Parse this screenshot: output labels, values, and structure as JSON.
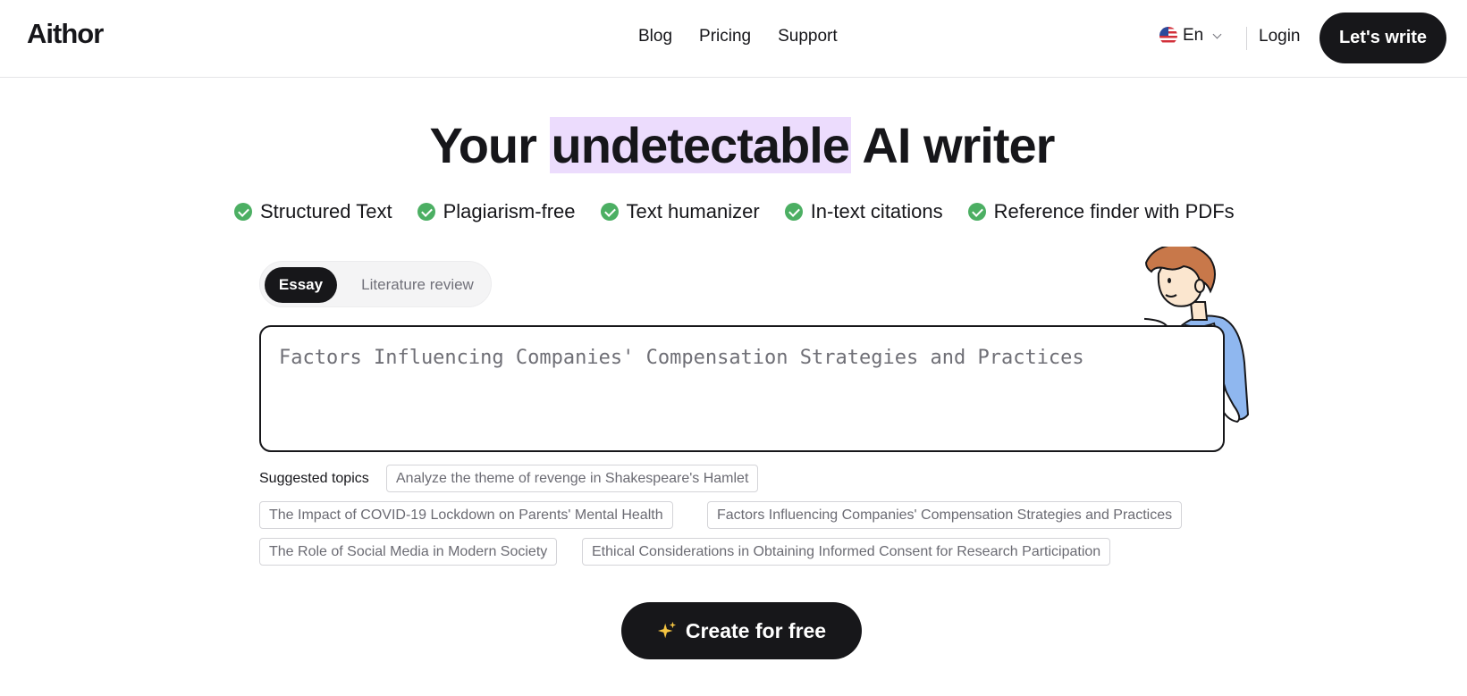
{
  "header": {
    "logo": "Aithor",
    "nav": [
      "Blog",
      "Pricing",
      "Support"
    ],
    "language": "En",
    "login": "Login",
    "cta": "Let's write"
  },
  "hero": {
    "title_before": "Your",
    "title_highlight": "undetectable",
    "title_after": "AI writer",
    "highlight_color": "#ecdcfd"
  },
  "features": [
    "Structured Text",
    "Plagiarism-free",
    "Text humanizer",
    "In-text citations",
    "Reference finder with PDFs"
  ],
  "tabs": {
    "active": "Essay",
    "items": [
      "Essay",
      "Literature review"
    ]
  },
  "topic_input": {
    "placeholder": "Factors Influencing Companies' Compensation Strategies and Practices",
    "value": ""
  },
  "suggested": {
    "label": "Suggested topics",
    "topics": [
      "Analyze the theme of revenge in Shakespeare's Hamlet",
      "The Impact of COVID-19 Lockdown on Parents' Mental Health",
      "Factors Influencing Companies' Compensation Strategies and Practices",
      "The Role of Social Media in Modern Society",
      "Ethical Considerations in Obtaining Informed Consent for Research Participation"
    ]
  },
  "create_button": "Create for free",
  "colors": {
    "accent_dark": "#17171a",
    "check_green": "#4caf63",
    "sparkle": "#f5c542"
  }
}
